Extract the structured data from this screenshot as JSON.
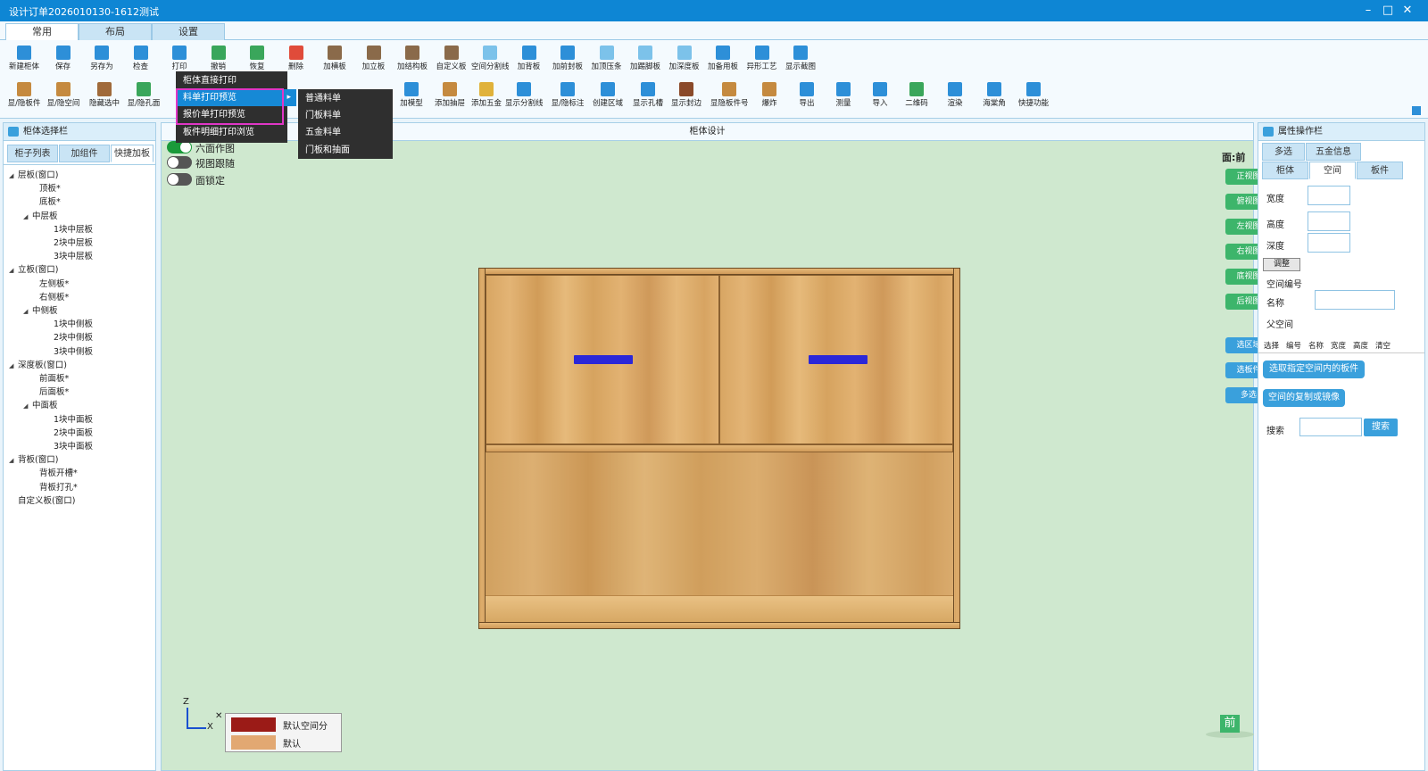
{
  "window": {
    "title": "设计订单2026010130-1612测试",
    "controls": [
      "–",
      "□",
      "✕"
    ]
  },
  "ribbon_tabs": [
    "常用",
    "布局",
    "设置"
  ],
  "toolbar_row1": [
    {
      "label": "新建柜体",
      "icon": "new-cabinet-icon",
      "color": "#2d8fd8"
    },
    {
      "label": "保存",
      "icon": "save-icon",
      "color": "#2d8fd8"
    },
    {
      "label": "另存为",
      "icon": "save-as-icon",
      "color": "#2d8fd8"
    },
    {
      "label": "检查",
      "icon": "check-icon",
      "color": "#2d8fd8"
    },
    {
      "label": "打印",
      "icon": "print-icon",
      "color": "#2d8fd8"
    },
    {
      "label": "撤销",
      "icon": "undo-icon",
      "color": "#3aa65b"
    },
    {
      "label": "恢复",
      "icon": "redo-icon",
      "color": "#3aa65b"
    },
    {
      "label": "删除",
      "icon": "delete-icon",
      "color": "#e04b3a"
    },
    {
      "label": "加横板",
      "icon": "horizontal-board-icon",
      "color": "#8a6a4a"
    },
    {
      "label": "加立板",
      "icon": "vertical-board-icon",
      "color": "#8a6a4a"
    },
    {
      "label": "加结构板",
      "icon": "structure-board-icon",
      "color": "#8a6a4a"
    },
    {
      "label": "自定义板",
      "icon": "custom-board-icon",
      "color": "#8a6a4a"
    },
    {
      "label": "空间分割线",
      "icon": "space-split-icon",
      "color": "#7cc2ea"
    },
    {
      "label": "加背板",
      "icon": "back-board-icon",
      "color": "#2d8fd8"
    },
    {
      "label": "加前封板",
      "icon": "front-seal-icon",
      "color": "#2d8fd8"
    },
    {
      "label": "加顶压条",
      "icon": "top-strip-icon",
      "color": "#7cc2ea"
    },
    {
      "label": "加踢脚板",
      "icon": "kick-board-icon",
      "color": "#7cc2ea"
    },
    {
      "label": "加深度板",
      "icon": "depth-board-icon",
      "color": "#7cc2ea"
    },
    {
      "label": "加备用板",
      "icon": "spare-board-icon",
      "color": "#2d8fd8"
    },
    {
      "label": "异形工艺",
      "icon": "shaped-process-icon",
      "color": "#2d8fd8"
    },
    {
      "label": "显示截图",
      "icon": "screenshot-icon",
      "color": "#2d8fd8"
    }
  ],
  "toolbar_row2": [
    {
      "label": "显/隐板件",
      "icon": "toggle-boards-icon",
      "color": "#c58a3f"
    },
    {
      "label": "显/隐空间",
      "icon": "toggle-space-icon",
      "color": "#c58a3f"
    },
    {
      "label": "隐藏选中",
      "icon": "hide-selected-icon",
      "color": "#a06a3a"
    },
    {
      "label": "显/隐孔面",
      "icon": "toggle-hole-face-icon",
      "color": "#3aa65b"
    },
    {
      "label": "加模型",
      "icon": "add-model-icon",
      "color": "#2d8fd8"
    },
    {
      "label": "添加抽屉",
      "icon": "add-drawer-icon",
      "color": "#c58a3f"
    },
    {
      "label": "添加五金",
      "icon": "add-hardware-icon",
      "color": "#e0b23a"
    },
    {
      "label": "显示分割线",
      "icon": "show-split-icon",
      "color": "#2d8fd8"
    },
    {
      "label": "显/隐标注",
      "icon": "toggle-dimension-icon",
      "color": "#2d8fd8"
    },
    {
      "label": "创建区域",
      "icon": "create-area-icon",
      "color": "#2d8fd8"
    },
    {
      "label": "显示孔槽",
      "icon": "show-holes-icon",
      "color": "#2d8fd8"
    },
    {
      "label": "显示封边",
      "icon": "show-edge-icon",
      "color": "#8a4a2a"
    },
    {
      "label": "显隐板件号",
      "icon": "toggle-board-no-icon",
      "color": "#c58a3f"
    },
    {
      "label": "爆炸",
      "icon": "explode-icon",
      "color": "#c58a3f"
    },
    {
      "label": "导出",
      "icon": "export-icon",
      "color": "#2d8fd8"
    },
    {
      "label": "测量",
      "icon": "measure-icon",
      "color": "#2d8fd8"
    },
    {
      "label": "导入",
      "icon": "import-icon",
      "color": "#2d8fd8"
    },
    {
      "label": "二维码",
      "icon": "qrcode-icon",
      "color": "#3aa65b"
    },
    {
      "label": "渲染",
      "icon": "render-icon",
      "color": "#2d8fd8"
    },
    {
      "label": "海棠角",
      "icon": "haitang-corner-icon",
      "color": "#2d8fd8"
    },
    {
      "label": "快捷功能",
      "icon": "shortcut-icon",
      "color": "#2d8fd8"
    }
  ],
  "print_menu": {
    "items": [
      "柜体直接打印",
      "料单打印预览",
      "报价单打印预览",
      "板件明细打印浏览"
    ],
    "submenu": [
      "普通料单",
      "门板料单",
      "五金料单",
      "门板和抽面"
    ],
    "submenu_arrow": "▸"
  },
  "left_panel": {
    "title": "柜体选择栏",
    "tabs": [
      "柜子列表",
      "加组件",
      "快捷加板"
    ],
    "tree": [
      {
        "label": "层板(窗口)",
        "level": 0,
        "toggle": "◢"
      },
      {
        "label": "顶板*",
        "level": 2,
        "toggle": ""
      },
      {
        "label": "底板*",
        "level": 2,
        "toggle": ""
      },
      {
        "label": "中层板",
        "level": 1,
        "toggle": "◢"
      },
      {
        "label": "1块中层板",
        "level": 3,
        "toggle": ""
      },
      {
        "label": "2块中层板",
        "level": 3,
        "toggle": ""
      },
      {
        "label": "3块中层板",
        "level": 3,
        "toggle": ""
      },
      {
        "label": "立板(窗口)",
        "level": 0,
        "toggle": "◢"
      },
      {
        "label": "左侧板*",
        "level": 2,
        "toggle": ""
      },
      {
        "label": "右侧板*",
        "level": 2,
        "toggle": ""
      },
      {
        "label": "中侧板",
        "level": 1,
        "toggle": "◢"
      },
      {
        "label": "1块中侧板",
        "level": 3,
        "toggle": ""
      },
      {
        "label": "2块中侧板",
        "level": 3,
        "toggle": ""
      },
      {
        "label": "3块中侧板",
        "level": 3,
        "toggle": ""
      },
      {
        "label": "深度板(窗口)",
        "level": 0,
        "toggle": "◢"
      },
      {
        "label": "前面板*",
        "level": 2,
        "toggle": ""
      },
      {
        "label": "后面板*",
        "level": 2,
        "toggle": ""
      },
      {
        "label": "中面板",
        "level": 1,
        "toggle": "◢"
      },
      {
        "label": "1块中面板",
        "level": 3,
        "toggle": ""
      },
      {
        "label": "2块中面板",
        "level": 3,
        "toggle": ""
      },
      {
        "label": "3块中面板",
        "level": 3,
        "toggle": ""
      },
      {
        "label": "背板(窗口)",
        "level": 0,
        "toggle": "◢"
      },
      {
        "label": "背板开槽*",
        "level": 2,
        "toggle": ""
      },
      {
        "label": "背板打孔*",
        "level": 2,
        "toggle": ""
      },
      {
        "label": "自定义板(窗口)",
        "level": 0,
        "toggle": ""
      }
    ]
  },
  "canvas": {
    "title": "柜体设计",
    "toggles": [
      {
        "label": "六面作图",
        "on": true
      },
      {
        "label": "视图跟随",
        "on": false
      },
      {
        "label": "面锁定",
        "on": false
      }
    ],
    "face_label": "面:前",
    "view_buttons": [
      "正视图",
      "俯视图",
      "左视图",
      "右视图",
      "底视图",
      "后视图"
    ],
    "select_buttons": [
      "选区域",
      "选板件",
      "多选"
    ],
    "axes": {
      "z": "Z",
      "x": "X",
      "close": "✕"
    },
    "legend": [
      {
        "label": "默认空间分",
        "color": "#9b1b17"
      },
      {
        "label": "默认",
        "color": "#e2a872"
      }
    ],
    "front_badge": "前"
  },
  "right_panel": {
    "title": "属性操作栏",
    "tabs_top": [
      "多选",
      "五金信息"
    ],
    "tabs_sub": [
      "柜体",
      "空间",
      "板件"
    ],
    "fields": [
      "宽度",
      "高度",
      "深度"
    ],
    "adjust_button": "调整",
    "space_no_label": "空间编号",
    "name_label": "名称",
    "parent_label": "父空间",
    "columns": [
      "选择",
      "编号",
      "名称",
      "宽度",
      "高度",
      "清空"
    ],
    "action1": "选取指定空间内的板件",
    "action2": "空间的复制或镜像",
    "search_label": "搜索",
    "search_button": "搜索",
    "search_value": "",
    "field_values": {
      "width": "",
      "height": "",
      "depth": "",
      "name": ""
    }
  }
}
